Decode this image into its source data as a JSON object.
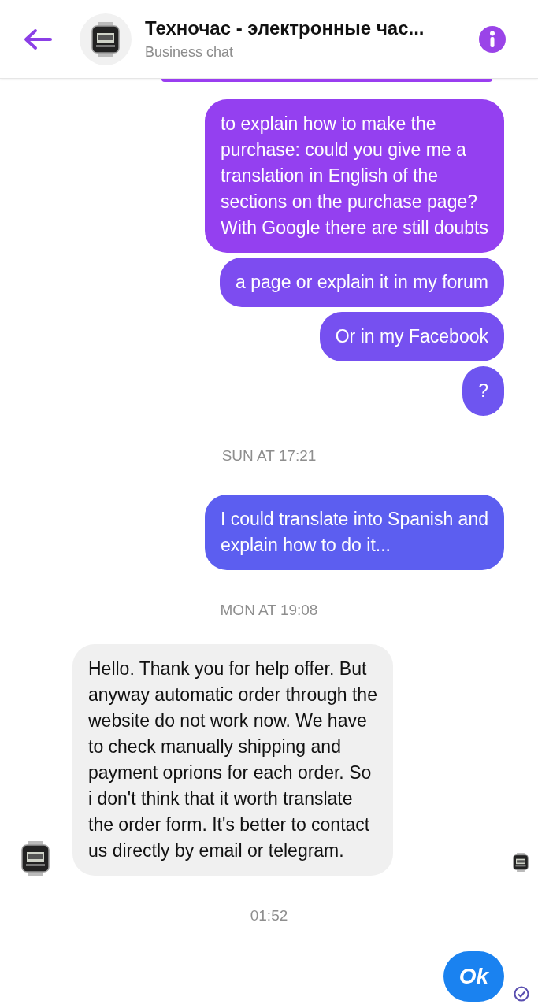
{
  "header": {
    "title": "Техночас - электронные час...",
    "subtitle": "Business chat"
  },
  "messages": [
    {
      "kind": "partial",
      "color": "#9a3ef0"
    },
    {
      "kind": "outgoing",
      "color": "#9440f0",
      "lines": [
        "to explain how to make the",
        "purchase: could you give me a",
        "translation in English of the",
        "sections on the purchase page?",
        "With Google there are still doubts"
      ]
    },
    {
      "kind": "outgoing",
      "color": "#7d4cf0",
      "lines": [
        "a page or explain it in my forum"
      ]
    },
    {
      "kind": "outgoing",
      "color": "#7650f0",
      "lines": [
        "Or in my Facebook"
      ]
    },
    {
      "kind": "outgoing",
      "color": "#6e55f0",
      "lines": [
        "?"
      ]
    },
    {
      "kind": "timestamp",
      "text": "SUN AT 17:21"
    },
    {
      "kind": "outgoing",
      "color": "#5c5ef0",
      "lines": [
        "I could translate into Spanish and",
        "explain how to do it..."
      ]
    },
    {
      "kind": "timestamp",
      "text": "MON AT 19:08"
    },
    {
      "kind": "incoming",
      "seen": true,
      "lines": [
        "Hello. Thank you for help offer. But",
        "anyway automatic order through the",
        "website do not work now. We have",
        "to check manually shipping and",
        "payment oprions for each order. So",
        "i don't think that it worth translate",
        "the order form. It's better to contact",
        "us directly by email or telegram."
      ]
    },
    {
      "kind": "timestamp",
      "text": "01:52"
    },
    {
      "kind": "big",
      "color": "#1a82f0",
      "delivered": true,
      "lines": [
        "Ok"
      ]
    }
  ]
}
